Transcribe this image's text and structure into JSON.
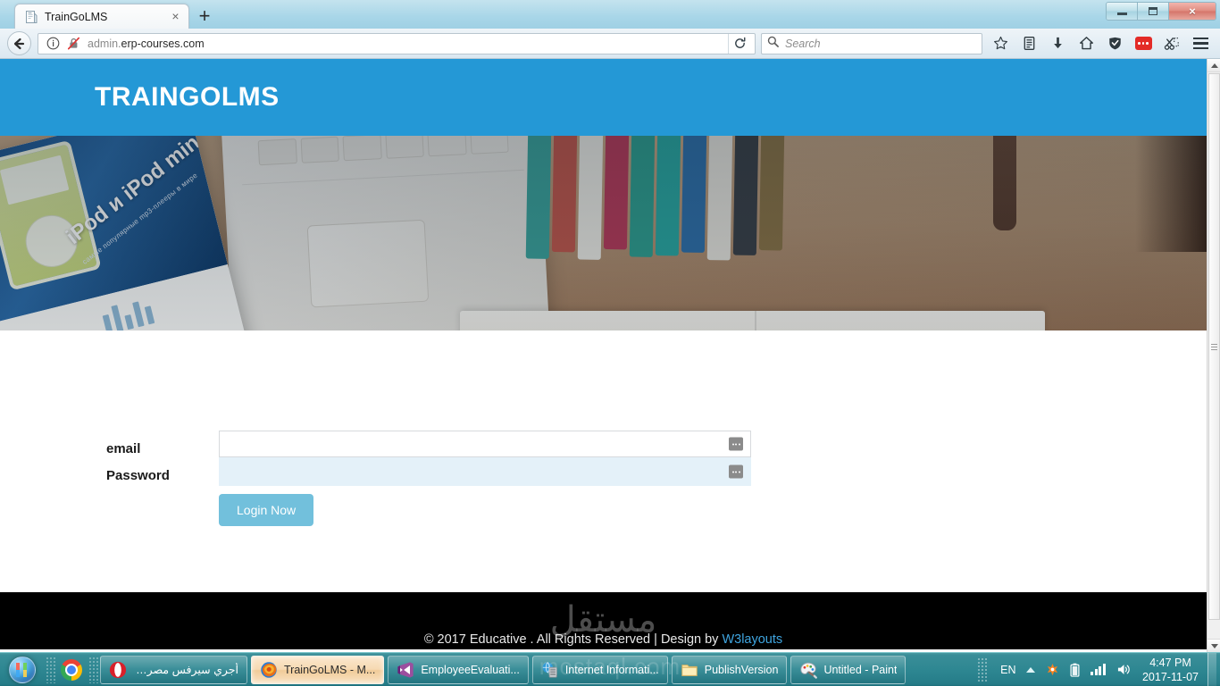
{
  "browser": {
    "tab": {
      "title": "TrainGoLMS",
      "close_label": "×",
      "favicon": "document-icon"
    },
    "new_tab_label": "+",
    "window_controls": {
      "minimize": "minimize-icon",
      "maximize": "maximize-icon",
      "close": "×"
    },
    "nav": {
      "back": "back-arrow-icon",
      "identity": "info-icon",
      "insecure": "crossed-lock-icon",
      "url_prefix": "admin.",
      "url_domain": "erp-courses.com",
      "url_full": "admin.erp-courses.com",
      "reload": "reload-icon"
    },
    "search": {
      "placeholder": "Search",
      "icon": "search-icon"
    },
    "toolbar_icons": [
      {
        "name": "bookmark-star-icon",
        "glyph": "☆"
      },
      {
        "name": "library-icon",
        "glyph": ""
      },
      {
        "name": "downloads-icon",
        "glyph": ""
      },
      {
        "name": "home-icon",
        "glyph": ""
      },
      {
        "name": "sync-shield-icon",
        "glyph": ""
      },
      {
        "name": "pocket-icon",
        "glyph": ""
      },
      {
        "name": "screenshot-scissors-icon",
        "glyph": ""
      },
      {
        "name": "menu-hamburger-icon",
        "glyph": ""
      }
    ]
  },
  "site": {
    "header": {
      "logo": "TRAINGOLMS",
      "bg_color": "#2498d6"
    },
    "hero": {
      "magazine_title": "iPod и iPod mini",
      "magazine_subtitle": "самые популярные mp3-плееры в мире",
      "book_colors": [
        "#3ba29a",
        "#c0564a",
        "#eceae3",
        "#b73a58",
        "#2f9e8e",
        "#2aa7a0",
        "#2f6fa8",
        "#e6e3db",
        "#3a3f45",
        "#8a7244"
      ]
    },
    "form": {
      "email_label": "email",
      "email_value": "",
      "email_placeholder": "",
      "password_label": "Password",
      "password_value": "",
      "password_placeholder": "",
      "submit_label": "Login Now",
      "submit_color": "#72c0dc",
      "autofill_icon": "autofill-dots-icon"
    },
    "footer": {
      "text": "© 2017 Educative . All Rights Reserved | Design by ",
      "link": "W3layouts",
      "watermark": "مستقل"
    }
  },
  "scrollbar": {
    "up": "scroll-up-arrow-icon",
    "down": "scroll-down-arrow-icon",
    "thumb": "scroll-thumb"
  },
  "taskbar": {
    "start": "windows-start-orb",
    "quicklaunch": [
      {
        "name": "chrome-icon",
        "label": "Google Chrome"
      }
    ],
    "buttons": [
      {
        "name": "taskbar-opera",
        "label": "أجري سيرفس مصر -...",
        "icon": "opera-icon",
        "rtl": true,
        "active": false
      },
      {
        "name": "taskbar-firefox",
        "label": "TrainGoLMS - M...",
        "icon": "firefox-icon",
        "rtl": false,
        "active": true
      },
      {
        "name": "taskbar-visualstudio",
        "label": "EmployeeEvaluati...",
        "icon": "visual-studio-icon",
        "rtl": false,
        "active": false
      },
      {
        "name": "taskbar-iis",
        "label": "Internet Informati...",
        "icon": "iis-manager-icon",
        "rtl": false,
        "active": false
      },
      {
        "name": "taskbar-explorer",
        "label": "PublishVersion",
        "icon": "folder-icon",
        "rtl": false,
        "active": false
      },
      {
        "name": "taskbar-paint",
        "label": "Untitled - Paint",
        "icon": "paint-palette-icon",
        "rtl": false,
        "active": false
      }
    ],
    "tray": {
      "language": "EN",
      "show_hidden": "show-hidden-icons-arrow",
      "items": [
        {
          "name": "antivirus-tray-icon"
        },
        {
          "name": "battery-tray-icon"
        },
        {
          "name": "network-signal-tray-icon"
        },
        {
          "name": "volume-tray-icon"
        }
      ],
      "time": "4:47 PM",
      "date": "2017-11-07"
    },
    "watermark": "mostaql.com"
  }
}
